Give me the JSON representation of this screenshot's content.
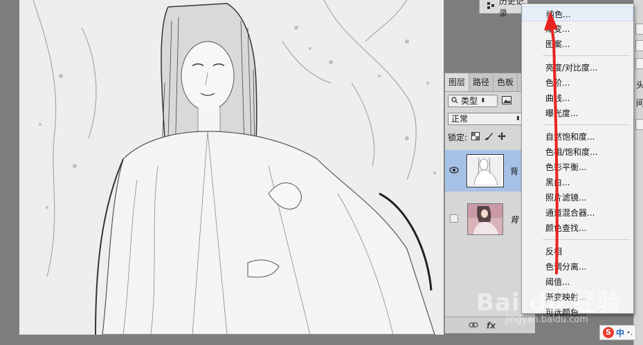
{
  "history_tab": {
    "label": "历史记录"
  },
  "layers_panel": {
    "tabs": [
      {
        "label": "图层"
      },
      {
        "label": "路径"
      },
      {
        "label": "色板"
      }
    ],
    "filter_label": "类型",
    "blend_mode": "正常",
    "lock_label": "锁定:",
    "layers": [
      {
        "name": "背",
        "selected": true,
        "visible": true
      },
      {
        "name": "背",
        "selected": false,
        "visible": false
      }
    ],
    "footer_fx": "fx"
  },
  "right_strip": {
    "text1": "头",
    "text2": "间"
  },
  "menu": {
    "groups": [
      [
        "纯色...",
        "渐变...",
        "图案..."
      ],
      [
        "亮度/对比度...",
        "色阶...",
        "曲线...",
        "曝光度..."
      ],
      [
        "自然饱和度...",
        "色相/饱和度...",
        "色彩平衡...",
        "黑白...",
        "照片滤镜...",
        "通道混合器...",
        "颜色查找..."
      ],
      [
        "反相",
        "色调分离...",
        "阈值...",
        "渐变映射...",
        "可选颜色..."
      ]
    ]
  },
  "watermark": {
    "text": "Bai du 经验",
    "sub": "jingyan.baidu.com"
  },
  "ime": {
    "label": "中"
  },
  "colors": {
    "arrow": "#e8231f",
    "selected_layer": "#a6c1e6",
    "menu_bg": "#f2f2f2"
  }
}
